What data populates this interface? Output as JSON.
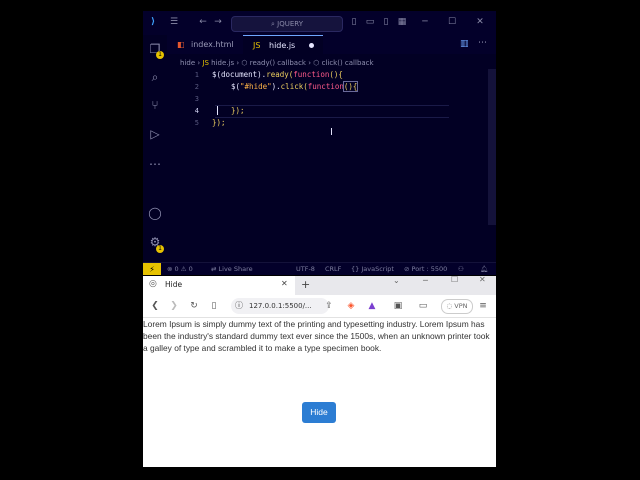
{
  "vscode": {
    "search": "JQUERY",
    "tabs": [
      {
        "label": "index.html",
        "icon": "html5-icon"
      },
      {
        "label": "hide.js",
        "icon": "javascript-icon"
      }
    ],
    "breadcrumb": {
      "folder": "hide",
      "file": "hide.js",
      "scope1": "ready() callback",
      "scope2": "click() callback"
    },
    "line_numbers": [
      "1",
      "2",
      "3",
      "4",
      "5"
    ],
    "code": {
      "l1a": "$(document).",
      "l1b": "ready",
      "l1c": "(",
      "l1d": "function",
      "l1e": "(){",
      "l2a": "$(",
      "l2b": "\"#hide\"",
      "l2c": ").",
      "l2d": "click",
      "l2e": "(",
      "l2f": "function",
      "l2g": "(){",
      "l4": "});",
      "l5": "});"
    },
    "status": {
      "errors": "0",
      "warnings": "0",
      "live_server": "Live Share",
      "encoding": "UTF-8",
      "eol": "CRLF",
      "language": "JavaScript",
      "port": "Port : 5500"
    },
    "colors": {
      "accent": "#e6c200",
      "bg": "#020024"
    }
  },
  "browser": {
    "tab_title": "Hide",
    "url": "127.0.0.1:5500/...",
    "vpn": "VPN",
    "paragraph": "Lorem Ipsum is simply dummy text of the printing and typesetting industry. Lorem Ipsum has been the industry's standard dummy text ever since the 1500s, when an unknown printer took a galley of type and scrambled it to make a type specimen book.",
    "button": "Hide",
    "colors": {
      "button": "#2c7dd3"
    }
  }
}
